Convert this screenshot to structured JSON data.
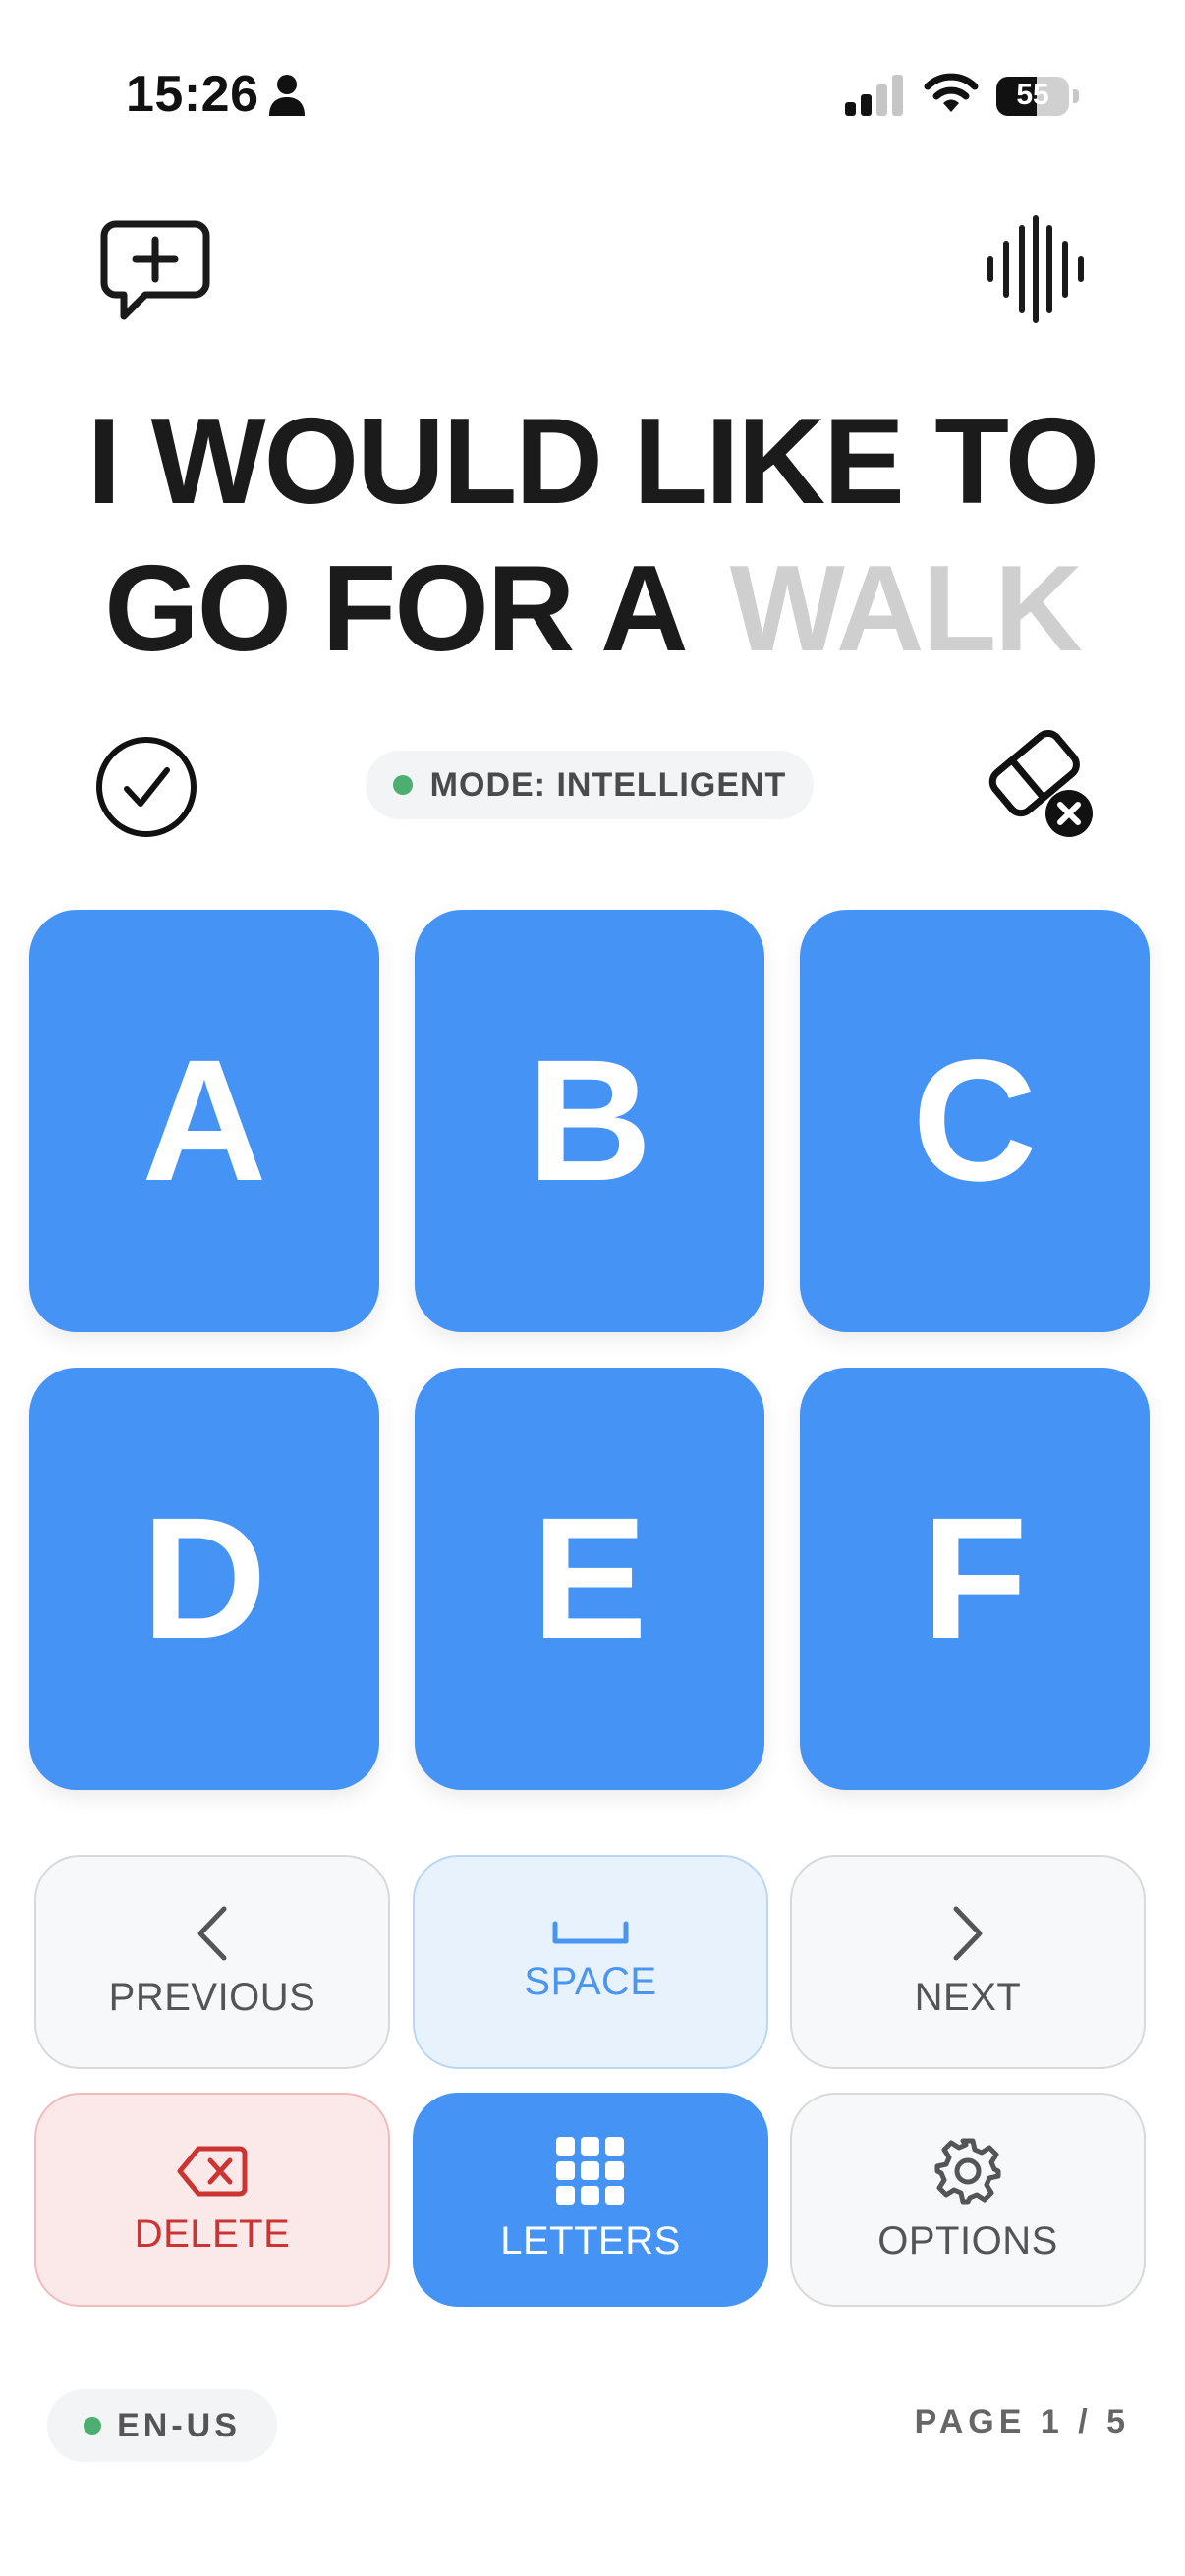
{
  "status_bar": {
    "time": "15:26",
    "battery_level": "55",
    "battery_fraction": 0.55
  },
  "phrase": {
    "typed": "I WOULD LIKE TO GO FOR A",
    "suggestion": "WALK"
  },
  "mode": {
    "label": "MODE: INTELLIGENT",
    "indicator_color": "#4caf70"
  },
  "letters": [
    "A",
    "B",
    "C",
    "D",
    "E",
    "F"
  ],
  "controls": {
    "previous": "PREVIOUS",
    "space": "SPACE",
    "next": "NEXT",
    "delete": "DELETE",
    "letters": "LETTERS",
    "options": "OPTIONS"
  },
  "footer": {
    "language": "EN-US",
    "page": "PAGE 1 / 5"
  },
  "colors": {
    "accent": "#4594f5",
    "delete": "#cc3333",
    "suggestion": "#cfcfcf"
  },
  "icons": {
    "new_message": "message-plus-icon",
    "voice": "sound-wave-icon",
    "confirm": "check-circle-icon",
    "erase": "eraser-clear-icon"
  }
}
